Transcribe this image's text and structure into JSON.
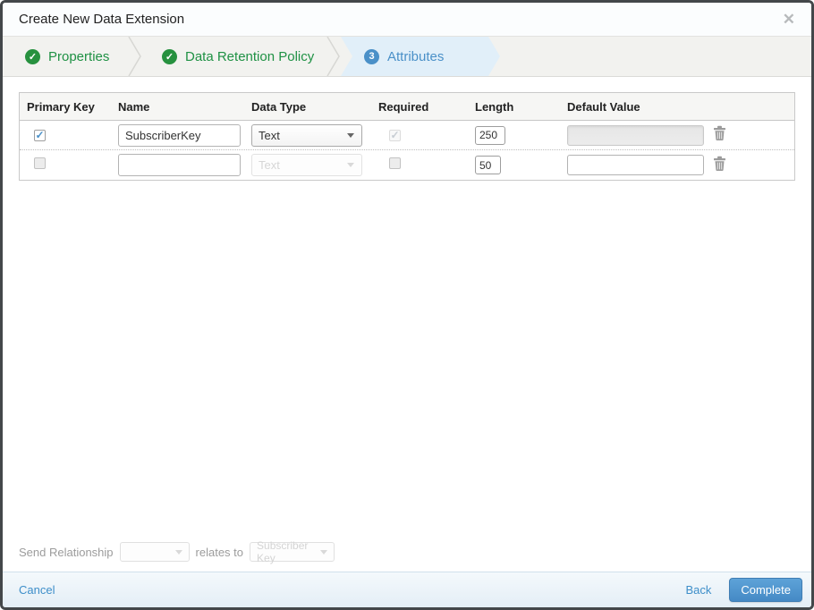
{
  "dialog": {
    "title": "Create New Data Extension",
    "close_glyph": "✕"
  },
  "wizard": {
    "steps": [
      {
        "label": "Properties",
        "state": "complete"
      },
      {
        "label": "Data Retention Policy",
        "state": "complete"
      },
      {
        "label": "Attributes",
        "state": "active",
        "number": "3"
      }
    ]
  },
  "attributes_table": {
    "headers": [
      "Primary Key",
      "Name",
      "Data Type",
      "Required",
      "Length",
      "Default Value"
    ],
    "rows": [
      {
        "primary_key_checked": true,
        "name": "SubscriberKey",
        "data_type": "Text",
        "data_type_disabled": false,
        "required_checked": true,
        "required_disabled": true,
        "length": "250",
        "default_value": "",
        "default_disabled": true
      },
      {
        "primary_key_checked": false,
        "name": "",
        "data_type": "Text",
        "data_type_disabled": true,
        "required_checked": false,
        "required_disabled": false,
        "length": "50",
        "default_value": "",
        "default_disabled": false
      }
    ]
  },
  "send_relationship": {
    "label": "Send Relationship",
    "relates_to": "relates to",
    "field_value": "",
    "target_value": "Subscriber Key"
  },
  "footer": {
    "cancel": "Cancel",
    "back": "Back",
    "complete": "Complete"
  },
  "colors": {
    "accent_blue": "#4a90c8",
    "success_green": "#27913f",
    "link_blue": "#3d8ec9",
    "active_step_bg": "#e1eff9",
    "button_blue": "#4589c5"
  }
}
